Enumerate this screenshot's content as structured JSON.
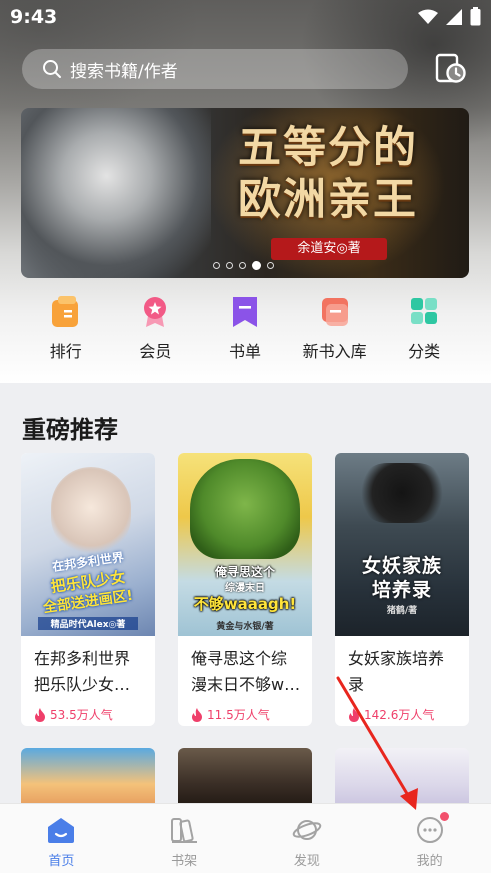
{
  "status_bar": {
    "time": "9:43"
  },
  "search": {
    "placeholder": "搜索书籍/作者"
  },
  "banner": {
    "title_line1": "五等分的",
    "title_line2": "欧洲亲王",
    "author": "余道安◎著",
    "slide_count": 5,
    "active_slide": 4
  },
  "quick_nav": [
    {
      "label": "排行",
      "icon": "ranking-icon",
      "color": "#f8a23a"
    },
    {
      "label": "会员",
      "icon": "vip-medal-icon",
      "color": "#f25a86"
    },
    {
      "label": "书单",
      "icon": "booklist-bookmark-icon",
      "color": "#8b53e8"
    },
    {
      "label": "新书入库",
      "icon": "new-books-icon",
      "color": "#f27360"
    },
    {
      "label": "分类",
      "icon": "category-grid-icon",
      "color": "#2ec7a2"
    }
  ],
  "recommend": {
    "title": "重磅推荐",
    "books": [
      {
        "title": "在邦多利世界把乐队少女…",
        "heat": "53.5万人气",
        "cover_text_1": "在邦多利世界",
        "cover_text_2": "把乐队少女",
        "cover_text_3": "全部送进画区!",
        "cover_author": "精品时代Alex◎著"
      },
      {
        "title": "俺寻思这个综漫末日不够w…",
        "heat": "11.5万人气",
        "cover_text_1": "俺寻思这个",
        "cover_text_2": "综漫末日",
        "cover_text_3": "不够waaagh!",
        "cover_author": "黄金与水银/著"
      },
      {
        "title": "女妖家族培养录",
        "heat": "142.6万人气",
        "cover_text_1": "女妖家族",
        "cover_text_2": "培养录",
        "cover_text_3": "",
        "cover_author": "猪鹤/著"
      }
    ]
  },
  "tabs": [
    {
      "label": "首页",
      "icon": "home-icon",
      "active": true
    },
    {
      "label": "书架",
      "icon": "bookshelf-icon",
      "active": false
    },
    {
      "label": "发现",
      "icon": "discover-planet-icon",
      "active": false
    },
    {
      "label": "我的",
      "icon": "profile-face-icon",
      "active": false
    }
  ],
  "colors": {
    "accent": "#4a7ee8",
    "heat": "#ef3f6a",
    "badge": "#f2506c"
  }
}
